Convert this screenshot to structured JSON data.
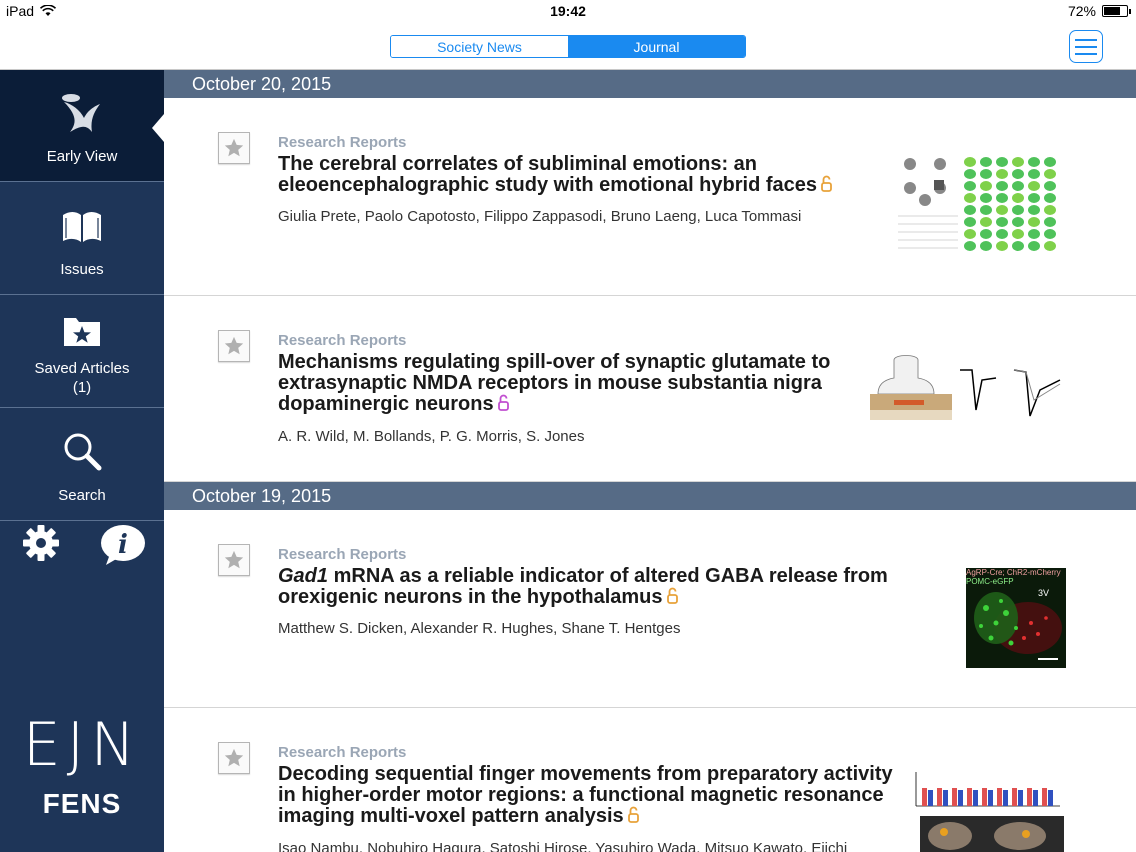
{
  "status_bar": {
    "device": "iPad",
    "time": "19:42",
    "battery": "72%",
    "battery_level": 0.72
  },
  "header": {
    "tabs": [
      {
        "label": "Society News",
        "active": false
      },
      {
        "label": "Journal",
        "active": true
      }
    ]
  },
  "sidebar": {
    "items": [
      {
        "label": "Early View",
        "icon": "early-view-icon",
        "active": true
      },
      {
        "label": "Issues",
        "icon": "book-icon",
        "active": false
      },
      {
        "label": "Saved Articles",
        "count": "(1)",
        "icon": "saved-folder-icon",
        "active": false
      },
      {
        "label": "Search",
        "icon": "search-icon",
        "active": false
      }
    ],
    "logo_text": "EJN",
    "logo_subtext": "FENS"
  },
  "colors": {
    "sidebar_bg": "#1e3558",
    "sidebar_active_bg": "#0b1d38",
    "accent": "#1a8af0",
    "date_header_bg": "#566b86",
    "lock_open_access": "#e8a23a",
    "lock_purple": "#c14fd0"
  },
  "sections": [
    {
      "date": "October 20, 2015",
      "articles": [
        {
          "category": "Research Reports",
          "title": "The cerebral correlates of subliminal emotions: an eleoencephalographic study with emotional hybrid faces",
          "lock": "orange",
          "authors": "Giulia Prete, Paolo Capotosto, Filippo Zappasodi, Bruno Laeng, Luca Tommasi"
        },
        {
          "category": "Research Reports",
          "title": "Mechanisms regulating spill-over of synaptic glutamate to extrasynaptic NMDA receptors in mouse substantia nigra dopaminergic neurons",
          "lock": "purple",
          "authors": "A. R. Wild, M. Bollands, P. G. Morris, S. Jones"
        }
      ]
    },
    {
      "date": "October 19, 2015",
      "articles": [
        {
          "category": "Research Reports",
          "title_italic": "Gad1",
          "title": " mRNA as a reliable indicator of altered GABA release from orexigenic neurons in the hypothalamus",
          "lock": "orange",
          "authors": "Matthew S. Dicken, Alexander R. Hughes, Shane T. Hentges",
          "thumb_text_1": "AgRP-Cre; ChR2-mCherry",
          "thumb_text_2": "POMC-eGFP",
          "thumb_text_3": "3V"
        },
        {
          "category": "Research Reports",
          "title": "Decoding sequential finger movements from preparatory activity in higher-order motor regions: a functional magnetic resonance imaging multi-voxel pattern analysis",
          "lock": "orange",
          "authors": "Isao Nambu, Nobuhiro Hagura, Satoshi Hirose, Yasuhiro Wada, Mitsuo Kawato, Eiichi"
        }
      ]
    }
  ]
}
